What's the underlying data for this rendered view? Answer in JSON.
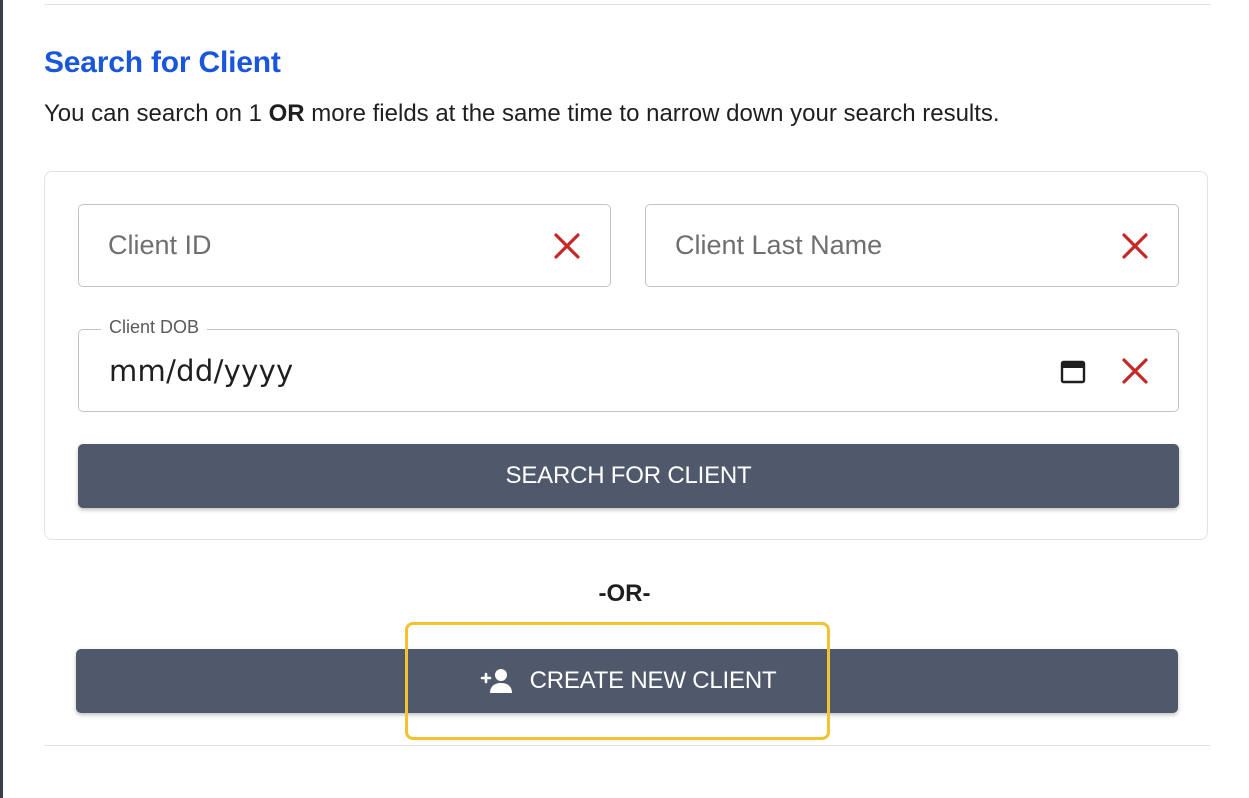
{
  "search": {
    "title": "Search for Client",
    "description_before": "You can search on 1 ",
    "description_bold": "OR",
    "description_after": " more fields at the same time to narrow down your search results.",
    "client_id_placeholder": "Client ID",
    "last_name_placeholder": "Client Last Name",
    "dob_label": "Client DOB",
    "dob_value": "mm/dd/yyyy",
    "search_button_label": "SEARCH FOR CLIENT"
  },
  "divider_text": "-OR-",
  "create": {
    "button_label": "CREATE NEW CLIENT"
  },
  "colors": {
    "accent": "#1a56db",
    "button": "#4f596b",
    "clear_icon": "#c62828",
    "highlight": "#f2c230"
  },
  "icons": {
    "clear": "close-x-icon",
    "calendar": "calendar-icon",
    "add_person": "person-add-icon"
  }
}
